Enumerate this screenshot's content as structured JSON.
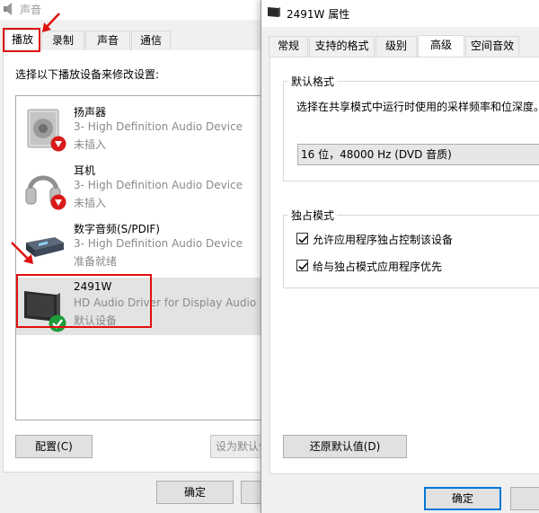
{
  "sound_dialog": {
    "title": "声音",
    "tabs": [
      {
        "label": "播放",
        "active": true
      },
      {
        "label": "录制",
        "active": false
      },
      {
        "label": "声音",
        "active": false
      },
      {
        "label": "通信",
        "active": false
      }
    ],
    "instruction": "选择以下播放设备来修改设置:",
    "devices": [
      {
        "name": "扬声器",
        "description": "3- High Definition Audio Device",
        "status": "未插入",
        "icon": "speaker-icon",
        "badge": "down-arrow-badge"
      },
      {
        "name": "耳机",
        "description": "3- High Definition Audio Device",
        "status": "未插入",
        "icon": "headphones-icon",
        "badge": "down-arrow-badge"
      },
      {
        "name": "数字音频(S/PDIF)",
        "description": "3- High Definition Audio Device",
        "status": "准备就绪",
        "icon": "spdif-device-icon",
        "badge": ""
      },
      {
        "name": "2491W",
        "description": "HD Audio Driver for Display Audio",
        "status": "默认设备",
        "icon": "monitor-icon",
        "badge": "check-badge",
        "selected": true
      }
    ],
    "configure_button": "配置(C)",
    "set_default_button": "设为默认值",
    "ok_button": "确定"
  },
  "properties_dialog": {
    "title": "2491W 属性",
    "tabs": [
      {
        "label": "常规",
        "active": false
      },
      {
        "label": "支持的格式",
        "active": false
      },
      {
        "label": "级别",
        "active": false
      },
      {
        "label": "高级",
        "active": true
      },
      {
        "label": "空间音效",
        "active": false
      }
    ],
    "default_format": {
      "group_label": "默认格式",
      "description": "选择在共享模式中运行时使用的采样频率和位深度。",
      "selected_format": "16 位，48000 Hz (DVD 音质)"
    },
    "exclusive_mode": {
      "group_label": "独占模式",
      "options": [
        {
          "label": "允许应用程序独占控制该设备",
          "checked": true
        },
        {
          "label": "给与独占模式应用程序优先",
          "checked": true
        }
      ]
    },
    "restore_defaults_button": "还原默认值(D)",
    "ok_button": "确定"
  },
  "colors": {
    "highlight_red": "#e01010",
    "check_green": "#1e9c3a",
    "down_arrow_red": "#d91a1a"
  }
}
